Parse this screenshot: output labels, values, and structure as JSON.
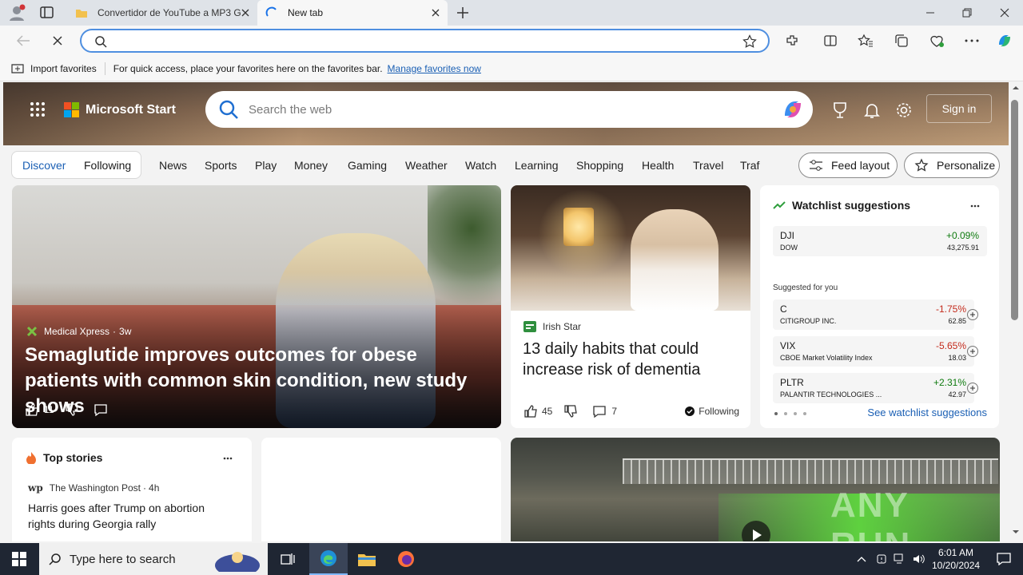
{
  "browser": {
    "tabs": [
      {
        "title": "Convertidor de YouTube a MP3 G",
        "active": false
      },
      {
        "title": "New tab",
        "active": true
      }
    ],
    "address": {
      "value": "",
      "placeholder": ""
    },
    "favorites_bar": {
      "import_label": "Import favorites",
      "hint": "For quick access, place your favorites here on the favorites bar.",
      "manage_link": "Manage favorites now"
    }
  },
  "header": {
    "brand": "Microsoft Start",
    "search_placeholder": "Search the web",
    "sign_in": "Sign in"
  },
  "nav": {
    "toggle": [
      "Discover",
      "Following"
    ],
    "links": [
      "News",
      "Sports",
      "Play",
      "Money",
      "Gaming",
      "Weather",
      "Watch",
      "Learning",
      "Shopping",
      "Health",
      "Travel",
      "Traf"
    ],
    "feed_layout": "Feed layout",
    "personalize": "Personalize"
  },
  "hero_story": {
    "source": "Medical Xpress",
    "age": "3w",
    "title": "Semaglutide improves outcomes for obese patients with common skin condition, new study shows",
    "likes": "11"
  },
  "story2": {
    "source": "Irish Star",
    "title": "13 daily habits that could increase risk of dementia",
    "likes": "45",
    "comments": "7",
    "following": "Following"
  },
  "watchlist": {
    "title": "Watchlist suggestions",
    "index": {
      "symbol": "DJI",
      "name": "DOW",
      "change": "+0.09%",
      "price": "43,275.91"
    },
    "suggested_label": "Suggested for you",
    "items": [
      {
        "symbol": "C",
        "name": "CITIGROUP INC.",
        "change": "-1.75%",
        "price": "62.85"
      },
      {
        "symbol": "VIX",
        "name": "CBOE Market Volatility Index",
        "change": "-5.65%",
        "price": "18.03"
      },
      {
        "symbol": "PLTR",
        "name": "PALANTIR TECHNOLOGIES ...",
        "change": "+2.31%",
        "price": "42.97"
      }
    ],
    "see_link": "See watchlist suggestions",
    "colors": {
      "up": "#0f7b0f",
      "down": "#c42b1c"
    }
  },
  "top_stories": {
    "title": "Top stories",
    "source": "The Washington Post",
    "age": "4h",
    "headline": "Harris goes after Trump on abortion rights during Georgia rally"
  },
  "video": {
    "watermark": "ANY RUN"
  },
  "taskbar": {
    "search_placeholder": "Type here to search",
    "time": "6:01 AM",
    "date": "10/20/2024"
  }
}
